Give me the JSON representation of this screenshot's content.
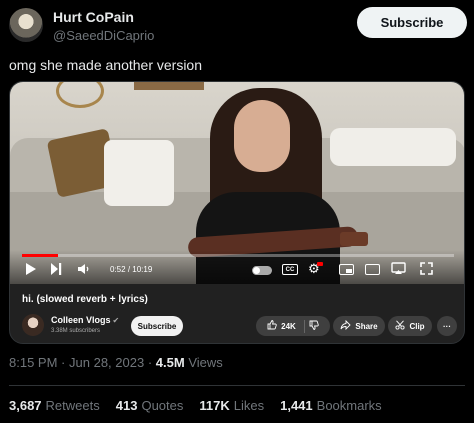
{
  "tweet": {
    "display_name": "Hurt CoPain",
    "handle": "@SaeedDiCaprio",
    "subscribe_label": "Subscribe",
    "text": "omg she made another version",
    "time": "8:15 PM",
    "date": "Jun 28, 2023",
    "separator": "·",
    "views_count": "4.5M",
    "views_label": "Views"
  },
  "video": {
    "current_time": "0:52",
    "duration": "10:19",
    "time_separator": "/",
    "progress_fraction": 0.084,
    "title": "hi. (slowed reverb + lyrics)",
    "channel_name": "Colleen Vlogs",
    "channel_subs": "3.38M subscribers",
    "subscribe_label": "Subscribe",
    "likes": "24K",
    "share_label": "Share",
    "clip_label": "Clip",
    "cc_label": "CC",
    "icons": [
      "play-icon",
      "next-icon",
      "volume-icon",
      "autoplay-toggle",
      "captions-icon",
      "settings-icon",
      "miniplayer-icon",
      "theater-icon",
      "cast-icon",
      "fullscreen-icon",
      "like-icon",
      "dislike-icon",
      "share-icon",
      "clip-icon",
      "more-icon"
    ]
  },
  "stats": [
    {
      "count": "3,687",
      "label": "Retweets"
    },
    {
      "count": "413",
      "label": "Quotes"
    },
    {
      "count": "117K",
      "label": "Likes"
    },
    {
      "count": "1,441",
      "label": "Bookmarks"
    }
  ],
  "colors": {
    "background": "#000000",
    "text_primary": "#e7e9ea",
    "text_secondary": "#71767b",
    "progress": "#ff0000"
  }
}
